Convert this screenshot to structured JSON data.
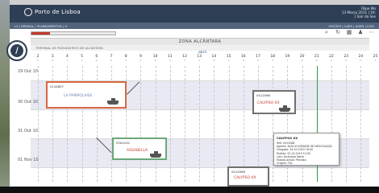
{
  "header": {
    "brand": "Porto de Lisboa",
    "user": "Filipe Mo",
    "date": "13 Março  2011 | 16:",
    "logout": "| Sair da Ses"
  },
  "nav": {
    "breadcrumb": "L3 | MENSAL | PLANEAMENTOS | 0",
    "links": "OPÇÕES | CAES | AGEN | LOGI"
  },
  "progress": {
    "fraction": 0.22,
    "color": "#c0392b"
  },
  "toolbar": [
    "search-icon",
    "refresh-icon",
    "grid-icon",
    "user-icon",
    "more-icon"
  ],
  "zone": {
    "title": "ZONA ALCÂNTARA",
    "subtitle": "TERMINAL DE PASSAGEIROS DE ALCÂNTARA"
  },
  "calendar": {
    "month": "abril",
    "days": [
      "2",
      "3",
      "4",
      "5",
      "6",
      "7",
      "8",
      "9",
      "10",
      "11",
      "12",
      "13",
      "14",
      "15",
      "16",
      "17",
      "18",
      "19",
      "20",
      "21",
      "22",
      "23",
      "24",
      "25"
    ],
    "day_subs": [
      "S",
      "D",
      "S",
      "T",
      "Q",
      "Q",
      "S",
      "S",
      "D",
      "S",
      "T",
      "Q",
      "Q",
      "S",
      "S",
      "D",
      "S",
      "T",
      "Q",
      "Q",
      "S",
      "S",
      "D",
      "S"
    ],
    "rows": [
      "29 Out 10",
      "30 Out 10",
      "31 Out 10",
      "01 Nov 10"
    ]
  },
  "ships": [
    {
      "id": "0144807",
      "name": "LA PAMPOLAISE",
      "border": "#d8683f"
    },
    {
      "id": "0412066",
      "name": "CALYPSO XX",
      "border": "#707070"
    },
    {
      "id": "0302242",
      "name": "ASSABELLA",
      "border": "#6aa878"
    },
    {
      "id": "0412066",
      "name": "CALYPSO XX",
      "border": "#707070"
    }
  ],
  "popup": {
    "title": "CALYPSO XX",
    "lines": [
      "IMO: 0412066",
      "Agente: ALFA SOCIEDADE DE NEGOCIAÇÃO",
      "Chegada: 19-10-2010 18:00",
      "Partida: 22-10-2010 12:00",
      "Cais: Alcântara Norte",
      "Estado Actual: Previsto",
      "Origem: FOL"
    ]
  }
}
